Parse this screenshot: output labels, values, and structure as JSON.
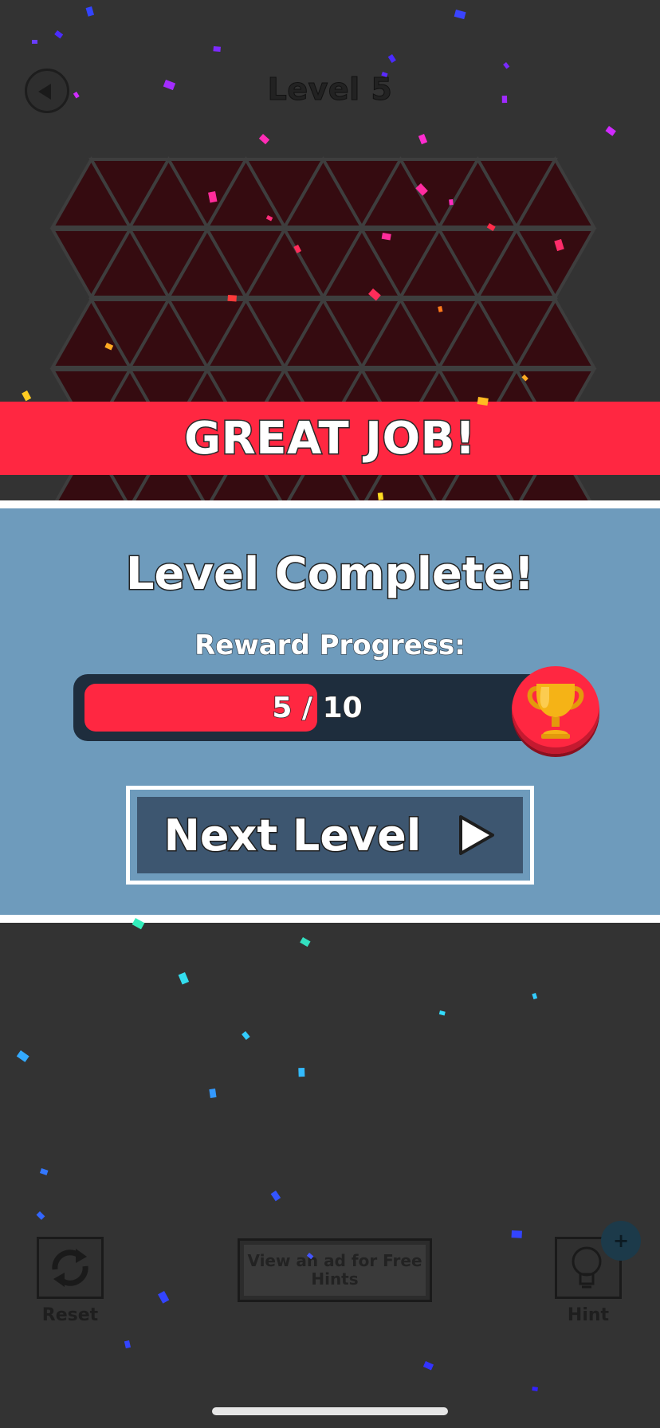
{
  "header": {
    "title": "Level 5"
  },
  "banner": {
    "text": "GREAT JOB!"
  },
  "results": {
    "title": "Level Complete!",
    "reward_label": "Reward Progress:",
    "progress": {
      "current": 5,
      "total": 10,
      "text": "5 / 10"
    },
    "next_button_label": "Next Level"
  },
  "toolbar": {
    "reset_label": "Reset",
    "ad_button_text": "View an ad for Free Hints",
    "hint_label": "Hint",
    "hint_plus": "+"
  },
  "colors": {
    "background": "#333333",
    "board_fill": "#350b10",
    "board_lines": "#3e3e3e",
    "banner_red": "#ff2741",
    "panel_blue": "#6e9bbc",
    "button_navy": "#3d5670",
    "trophy_gold": "#f5b316"
  }
}
